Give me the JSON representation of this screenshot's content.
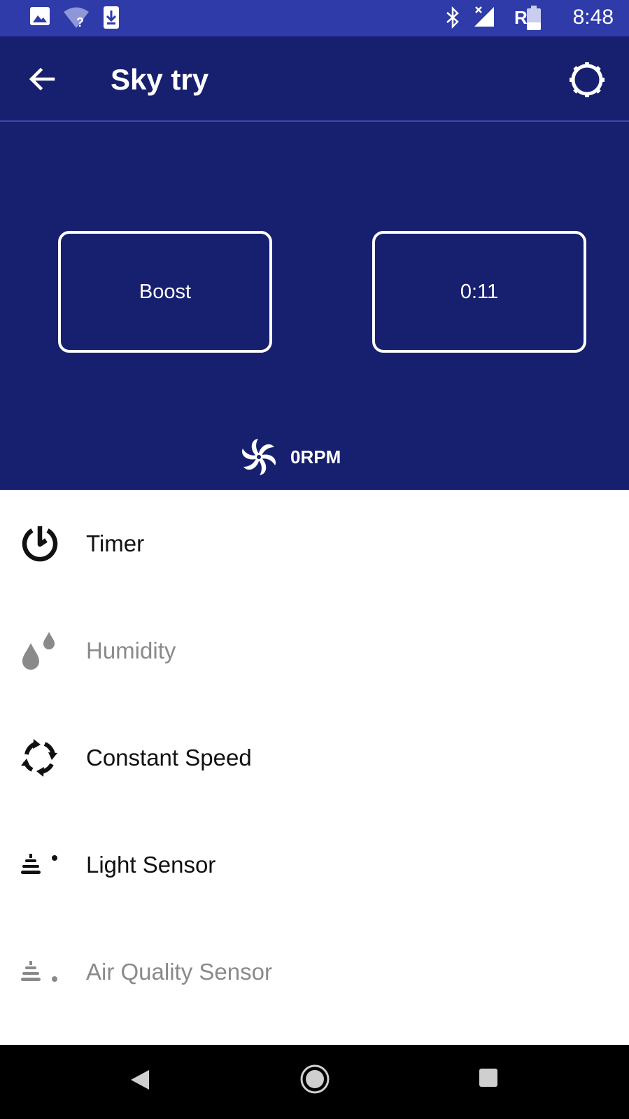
{
  "status_bar": {
    "time": "8:48",
    "carrier_indicator": "R",
    "icons": [
      "image-icon",
      "wifi-question-icon",
      "download-icon",
      "bluetooth-icon",
      "signal-off-icon",
      "battery-icon"
    ]
  },
  "app_bar": {
    "title": "Sky try",
    "icons": [
      "back-arrow-icon",
      "settings-gear-icon"
    ]
  },
  "hero": {
    "boost_label": "Boost",
    "timer_value": "0:11",
    "rpm": "0RPM"
  },
  "menu": {
    "items": [
      {
        "label": "Timer",
        "icon": "timer-icon",
        "enabled": true
      },
      {
        "label": "Humidity",
        "icon": "humidity-drops-icon",
        "enabled": false
      },
      {
        "label": "Constant Speed",
        "icon": "constant-speed-icon",
        "enabled": true
      },
      {
        "label": "Light Sensor",
        "icon": "light-sensor-icon",
        "enabled": true
      },
      {
        "label": "Air Quality Sensor",
        "icon": "air-quality-sensor-icon",
        "enabled": false
      }
    ]
  },
  "colors": {
    "status_bar": "#2e3ba8",
    "primary": "#17206e",
    "disabled_text": "#8a8a8a"
  }
}
